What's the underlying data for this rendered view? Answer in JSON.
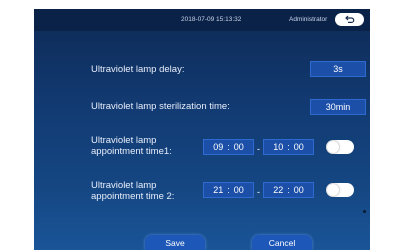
{
  "header": {
    "datetime": "2018-07-09  15:13:32",
    "user": "Administrator"
  },
  "settings": {
    "delay": {
      "label": "Ultraviolet lamp delay:",
      "value": "3s"
    },
    "sterilization": {
      "label": "Ultraviolet lamp sterilization time:",
      "value": "30min"
    },
    "appointment1": {
      "label_line1": "Ultraviolet lamp",
      "label_line2": "appointment time1:",
      "start_h": "09",
      "start_m": "00",
      "end_h": "10",
      "end_m": "00",
      "enabled": false
    },
    "appointment2": {
      "label_line1": "Ultraviolet lamp",
      "label_line2": "appointment time 2:",
      "start_h": "21",
      "start_m": "00",
      "end_h": "22",
      "end_m": "00",
      "enabled": false
    }
  },
  "buttons": {
    "save": "Save",
    "cancel": "Cancel"
  },
  "symbols": {
    "colon": ":",
    "dash": "-"
  },
  "colors": {
    "accent": "#1d57b8",
    "background": "#123a72"
  }
}
